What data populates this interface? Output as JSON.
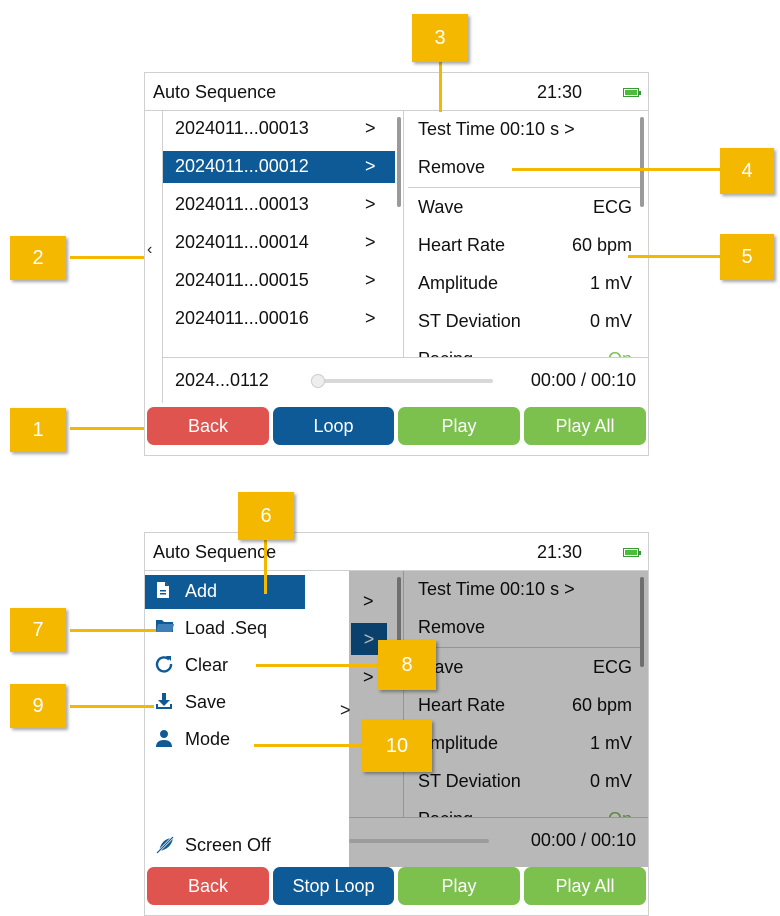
{
  "screen1": {
    "title": "Auto Sequence",
    "time": "21:30",
    "back_chevron": "‹",
    "files": [
      {
        "name": "2024011...00013",
        "arrow": ">"
      },
      {
        "name": "2024011...00012",
        "arrow": ">"
      },
      {
        "name": "2024011...00013",
        "arrow": ">"
      },
      {
        "name": "2024011...00014",
        "arrow": ">"
      },
      {
        "name": "2024011...00015",
        "arrow": ">"
      },
      {
        "name": "2024011...00016",
        "arrow": ">"
      }
    ],
    "test_time_label": "Test Time 00:10 s >",
    "remove_label": "Remove",
    "params": [
      {
        "label": "Wave",
        "value": "ECG"
      },
      {
        "label": "Heart Rate",
        "value": "60 bpm"
      },
      {
        "label": "Amplitude",
        "value": "1 mV"
      },
      {
        "label": "ST Deviation",
        "value": "0 mV"
      },
      {
        "label": "Pacing",
        "value": "On"
      }
    ],
    "playing_file": "2024...0112",
    "playback_time": "00:00 / 00:10",
    "buttons": {
      "back": "Back",
      "loop": "Loop",
      "play": "Play",
      "play_all": "Play All"
    }
  },
  "screen2": {
    "title": "Auto Sequence",
    "time": "21:30",
    "menu": [
      {
        "label": "Add",
        "icon": "file-icon"
      },
      {
        "label": "Load .Seq",
        "icon": "folder-icon"
      },
      {
        "label": "Clear",
        "icon": "refresh-icon"
      },
      {
        "label": "Save",
        "icon": "download-icon"
      },
      {
        "label": "Mode",
        "icon": "user-icon"
      }
    ],
    "save_arrow": ">",
    "screen_off": "Screen Off",
    "test_time_label": "Test Time 00:10 s >",
    "remove_label": "Remove",
    "params": [
      {
        "label": "Wave",
        "value": "ECG"
      },
      {
        "label": "Heart Rate",
        "value": "60 bpm"
      },
      {
        "label": "Amplitude",
        "value": "1 mV"
      },
      {
        "label": "ST Deviation",
        "value": "0 mV"
      },
      {
        "label": "Pacing",
        "value": "On"
      }
    ],
    "side_arrows": [
      ">",
      ">",
      ">"
    ],
    "playback_time": "00:00 / 00:10",
    "buttons": {
      "back": "Back",
      "stop_loop": "Stop Loop",
      "play": "Play",
      "play_all": "Play All"
    }
  },
  "callouts": [
    "1",
    "2",
    "3",
    "4",
    "5",
    "6",
    "7",
    "8",
    "9",
    "10"
  ],
  "colors": {
    "accent_blue": "#0e5a96",
    "back_red": "#e0544f",
    "play_green": "#7cc04e",
    "callout": "#f5b800"
  }
}
